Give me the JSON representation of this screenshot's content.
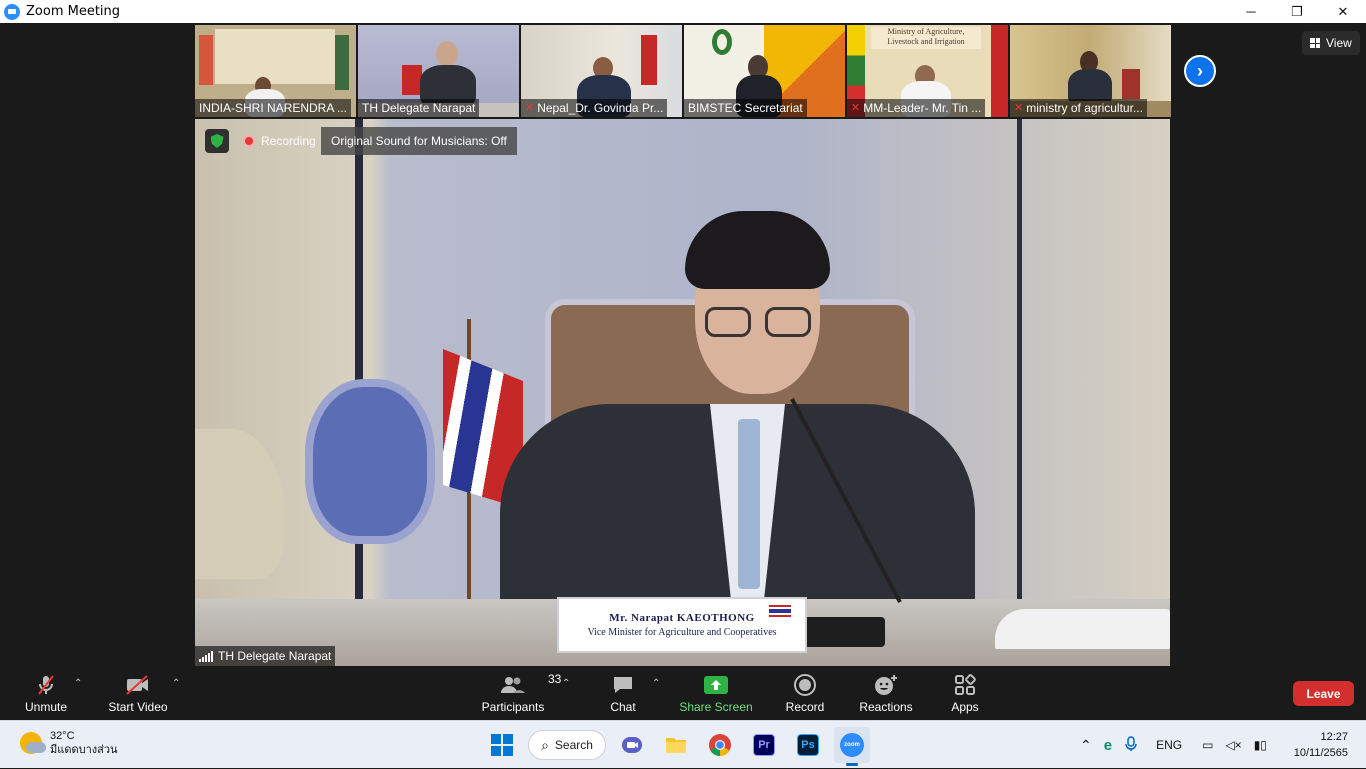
{
  "window": {
    "title": "Zoom Meeting",
    "minimize": "─",
    "restore": "❐",
    "close": "✕"
  },
  "thumbnails": [
    {
      "name": "INDIA-SHRI NARENDRA ...",
      "muted": false,
      "bg": "#bfae8a"
    },
    {
      "name": "TH Delegate Narapat",
      "muted": false,
      "bg": "#a9acc8",
      "active": true
    },
    {
      "name": "Nepal_Dr. Govinda Pr...",
      "muted": true,
      "bg": "#cfc9bb"
    },
    {
      "name": "BIMSTEC Secretariat",
      "muted": false,
      "bg": "#e4b32a"
    },
    {
      "name": "MM-Leader- Mr. Tin ...",
      "muted": true,
      "bg": "#d6c9a8"
    },
    {
      "name": "ministry of agricultur...",
      "muted": true,
      "bg": "#c8b583"
    }
  ],
  "view_button": {
    "label": "View"
  },
  "next_button": {
    "label": "›"
  },
  "main_video": {
    "recording_label": "Recording",
    "original_sound": "Original Sound for Musicians: Off",
    "participant_name": "TH Delegate Narapat",
    "nameplate_name": "Mr. Narapat  KAEOTHONG",
    "nameplate_title": "Vice Minister for Agriculture and Cooperatives"
  },
  "toolbar": {
    "unmute": "Unmute",
    "start_video": "Start Video",
    "participants": "Participants",
    "participants_count": "33",
    "chat": "Chat",
    "share_screen": "Share Screen",
    "record": "Record",
    "reactions": "Reactions",
    "apps": "Apps",
    "leave": "Leave",
    "share_color": "#2fb344"
  },
  "taskbar": {
    "temperature": "32°C",
    "weather_text": "มีแดดบางส่วน",
    "search_label": "Search",
    "language": "ENG",
    "time": "12:27",
    "date": "10/11/2565"
  }
}
